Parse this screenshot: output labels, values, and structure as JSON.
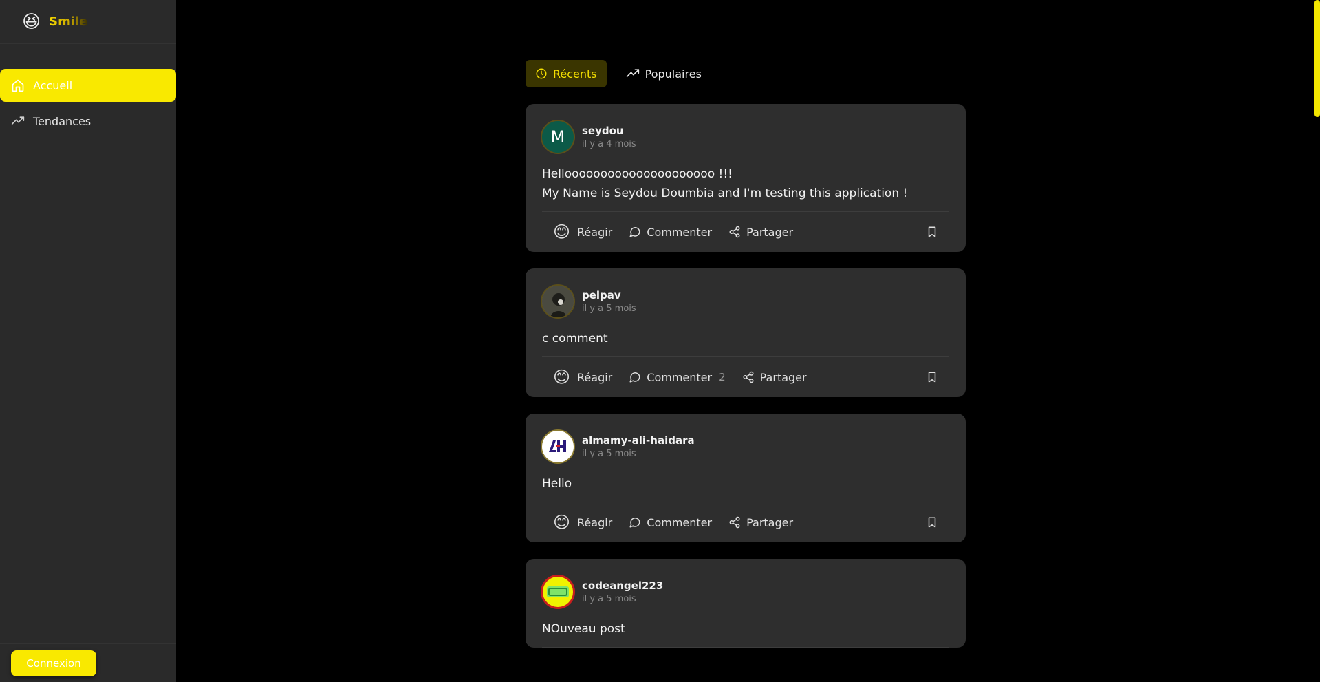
{
  "app": {
    "emoji": "😆",
    "name": "Smile"
  },
  "sidebar": {
    "items": [
      {
        "label": "Accueil",
        "icon": "home-icon",
        "active": true
      },
      {
        "label": "Tendances",
        "icon": "trending-icon",
        "active": false
      }
    ],
    "login_label": "Connexion"
  },
  "tabs": [
    {
      "label": "Récents",
      "icon": "clock-icon",
      "active": true
    },
    {
      "label": "Populaires",
      "icon": "trending-icon",
      "active": false
    }
  ],
  "actions": {
    "react_label": "Réagir",
    "react_emoji": "😊",
    "comment_label": "Commenter",
    "share_label": "Partager"
  },
  "posts": [
    {
      "username": "seydou",
      "time": "il y a 4 mois",
      "avatar_letter": "M",
      "body": "Hellooooooooooooooooooooo !!!\nMy Name is Seydou Doumbia and I'm testing this application !",
      "comments": ""
    },
    {
      "username": "pelpav",
      "time": "il y a 5 mois",
      "avatar_letter": "",
      "body": "c comment",
      "comments": "2"
    },
    {
      "username": "almamy-ali-haidara",
      "time": "il y a 5 mois",
      "avatar_letter": "",
      "body": "Hello",
      "comments": ""
    },
    {
      "username": "codeangel223",
      "time": "il y a 5 mois",
      "avatar_letter": "",
      "body": "NOuveau post",
      "comments": ""
    }
  ],
  "colors": {
    "accent": "#f9e900",
    "card": "#2e2e2e",
    "sidebar": "#2a2a2a",
    "background": "#000000"
  }
}
